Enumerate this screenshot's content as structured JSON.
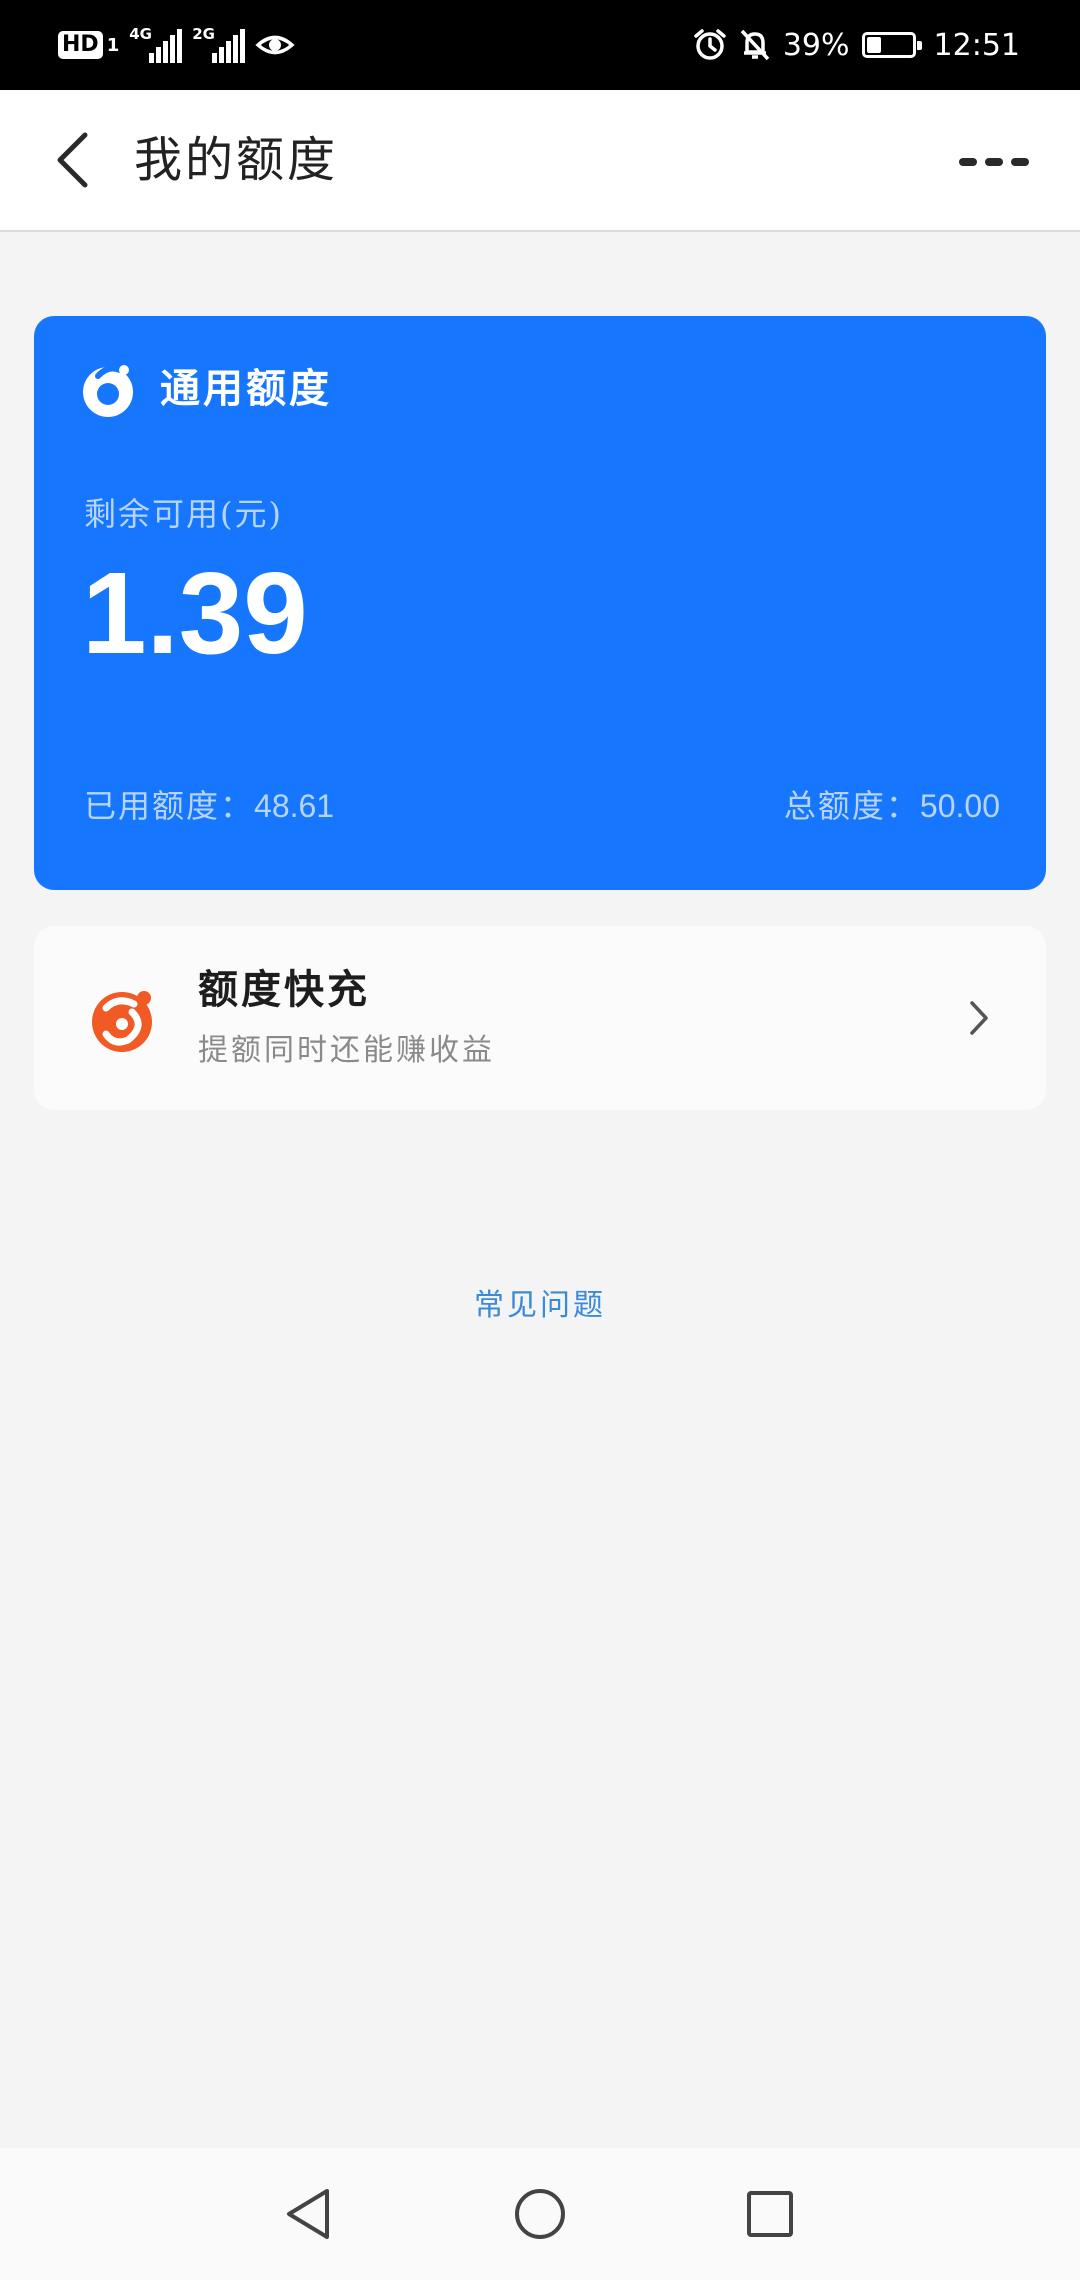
{
  "status_bar": {
    "hd": "HD",
    "hd_sub": "1",
    "net1": "4G",
    "net2": "2G",
    "battery_percent": "39%",
    "battery_level": 0.39,
    "time": "12:51",
    "icons": [
      "eye-icon",
      "alarm-icon",
      "mute-bell-icon",
      "battery-icon"
    ]
  },
  "header": {
    "title": "我的额度"
  },
  "quota_card": {
    "title": "通用额度",
    "remaining_label": "剩余可用(元)",
    "remaining_value": "1.39",
    "used_label": "已用额度：",
    "used_value": "48.61",
    "total_label": "总额度：",
    "total_value": "50.00",
    "color": "#1677fe"
  },
  "quick_charge": {
    "title": "额度快充",
    "subtitle": "提额同时还能赚收益",
    "icon_color": "#f15a24"
  },
  "faq": {
    "label": "常见问题",
    "color": "#3b8ad9"
  }
}
